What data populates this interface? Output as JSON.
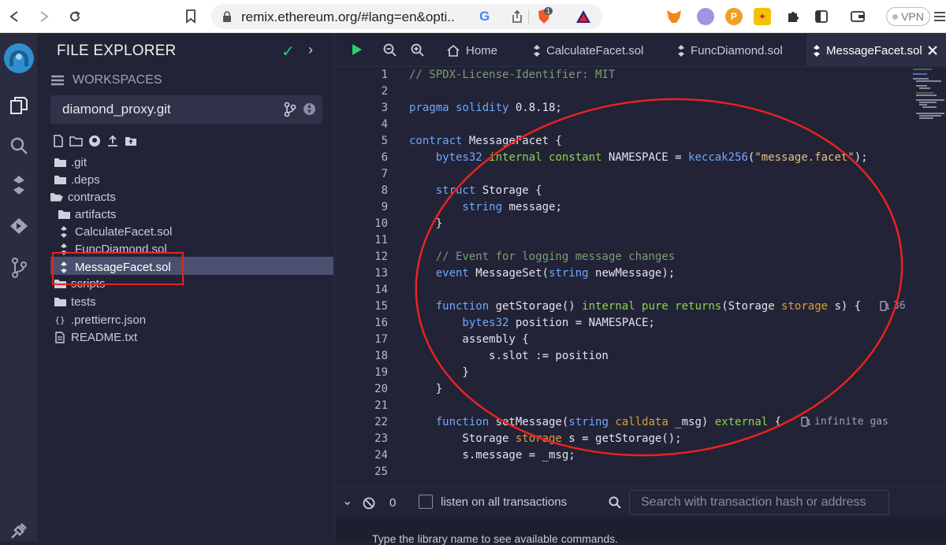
{
  "browser": {
    "url": "remix.ethereum.org/#lang=en&opti...",
    "vpn_label": "VPN",
    "brave_badge": "1"
  },
  "explorer": {
    "title": "FILE EXPLORER",
    "workspaces_label": "WORKSPACES",
    "workspace_name": "diamond_proxy.git",
    "tree": [
      {
        "label": ".git",
        "type": "folder"
      },
      {
        "label": ".deps",
        "type": "folder"
      },
      {
        "label": "contracts",
        "type": "folder-open"
      },
      {
        "label": "artifacts",
        "type": "folder"
      },
      {
        "label": "CalculateFacet.sol",
        "type": "sol"
      },
      {
        "label": "FuncDiamond.sol",
        "type": "sol"
      },
      {
        "label": "MessageFacet.sol",
        "type": "sol",
        "selected": true
      },
      {
        "label": "scripts",
        "type": "folder"
      },
      {
        "label": "tests",
        "type": "folder"
      },
      {
        "label": ".prettierrc.json",
        "type": "json"
      },
      {
        "label": "README.txt",
        "type": "txt"
      }
    ]
  },
  "editor": {
    "tabs": [
      {
        "label": "Home"
      },
      {
        "label": "CalculateFacet.sol"
      },
      {
        "label": "FuncDiamond.sol"
      },
      {
        "label": "MessageFacet.sol",
        "active": true
      }
    ],
    "line_numbers": [
      "1",
      "2",
      "3",
      "4",
      "5",
      "6",
      "7",
      "8",
      "9",
      "10",
      "11",
      "12",
      "13",
      "14",
      "15",
      "16",
      "17",
      "18",
      "19",
      "20",
      "21",
      "22",
      "23",
      "24",
      "25"
    ],
    "gas_hints": {
      "get_storage": "36",
      "set_message": "infinite gas"
    }
  },
  "code_tokens": {
    "l1": "// SPDX-License-Identifier: MIT",
    "l3a": "pragma solidity ",
    "l3b": "0.8.18;",
    "l5a": "contract ",
    "l5b": "MessageFacet {",
    "l6a": "    bytes32 ",
    "l6b": "internal ",
    "l6c": "constant ",
    "l6d": "NAMESPACE = ",
    "l6e": "keccak256",
    "l6f": "(",
    "l6g": "\"message.facet\"",
    "l6h": ");",
    "l8a": "    struct ",
    "l8b": "Storage {",
    "l9a": "        string ",
    "l9b": "message;",
    "l10": "    }",
    "l12": "    // Event for logging message changes",
    "l13a": "    event ",
    "l13b": "MessageSet(",
    "l13c": "string ",
    "l13d": "newMessage);",
    "l15a": "    function ",
    "l15b": "getStorage() ",
    "l15c": "internal ",
    "l15d": "pure ",
    "l15e": "returns",
    "l15f": "(Storage ",
    "l15g": "storage ",
    "l15h": "s) {",
    "l16a": "        bytes32 ",
    "l16b": "position = NAMESPACE;",
    "l17": "        assembly {",
    "l18": "            s.slot := position",
    "l19": "        }",
    "l20": "    }",
    "l22a": "    function ",
    "l22b": "setMessage(",
    "l22c": "string ",
    "l22d": "calldata ",
    "l22e": "_msg) ",
    "l22f": "external ",
    "l22g": "{",
    "l23a": "        Storage ",
    "l23b": "storage ",
    "l23c": "s = getStorage();",
    "l24": "        s.message = _msg;"
  },
  "terminal": {
    "count": "0",
    "listen_label": "listen on all transactions",
    "search_placeholder": "Search with transaction hash or address",
    "prompt_text": "Type the library name to see available commands."
  },
  "colors": {
    "annotation_red": "#e8231f",
    "background": "#222336",
    "selected_row": "#4c5070"
  }
}
